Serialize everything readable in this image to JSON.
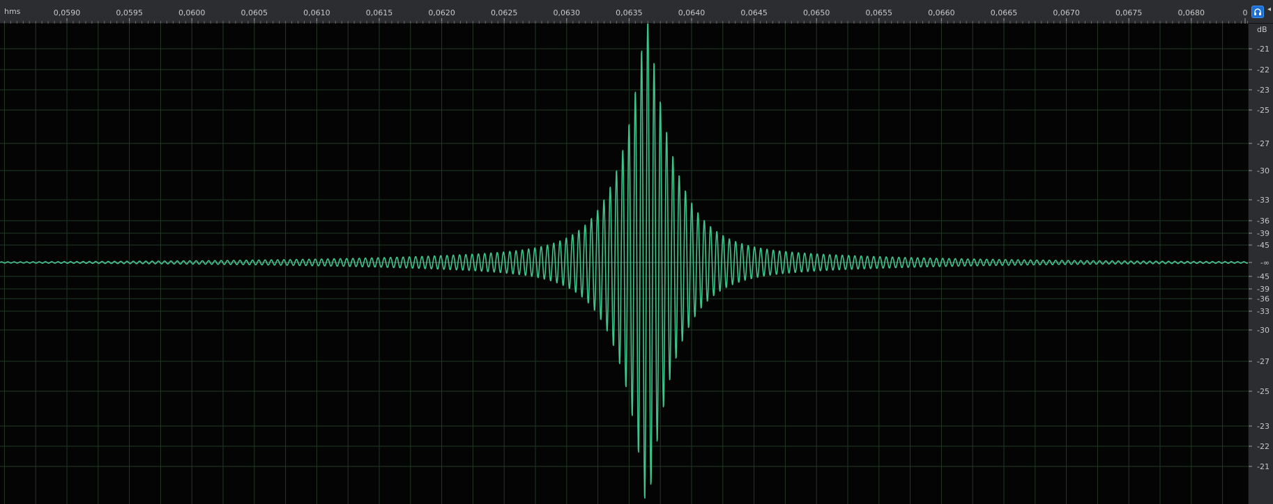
{
  "ruler": {
    "unit": "hms",
    "labels": [
      "0,0590",
      "0,0595",
      "0,0600",
      "0,0605",
      "0,0610",
      "0,0615",
      "0,0620",
      "0,0625",
      "0,0630",
      "0,0635",
      "0,0640",
      "0,0645",
      "0,0650",
      "0,0655",
      "0,0660",
      "0,0665",
      "0,0670",
      "0,0675",
      "0,0680",
      "0"
    ]
  },
  "db_ruler": {
    "unit": "dB",
    "labels": [
      "-21",
      "-22",
      "-23",
      "-25",
      "-27",
      "-30",
      "-33",
      "-36",
      "-39",
      "-45",
      "-∞",
      "-45",
      "-39",
      "-36",
      "-33",
      "-30",
      "-27",
      "-25",
      "-23",
      "-22",
      "-21"
    ]
  },
  "waveform": {
    "color": "#3ec58c",
    "peak_time": "0,0636"
  },
  "colors": {
    "background": "#040404",
    "grid": "#1f3a23",
    "ruler_bg": "#2b2d30",
    "button_blue": "#1d6fd6"
  },
  "icons": {
    "headphones": "headphones-icon"
  }
}
